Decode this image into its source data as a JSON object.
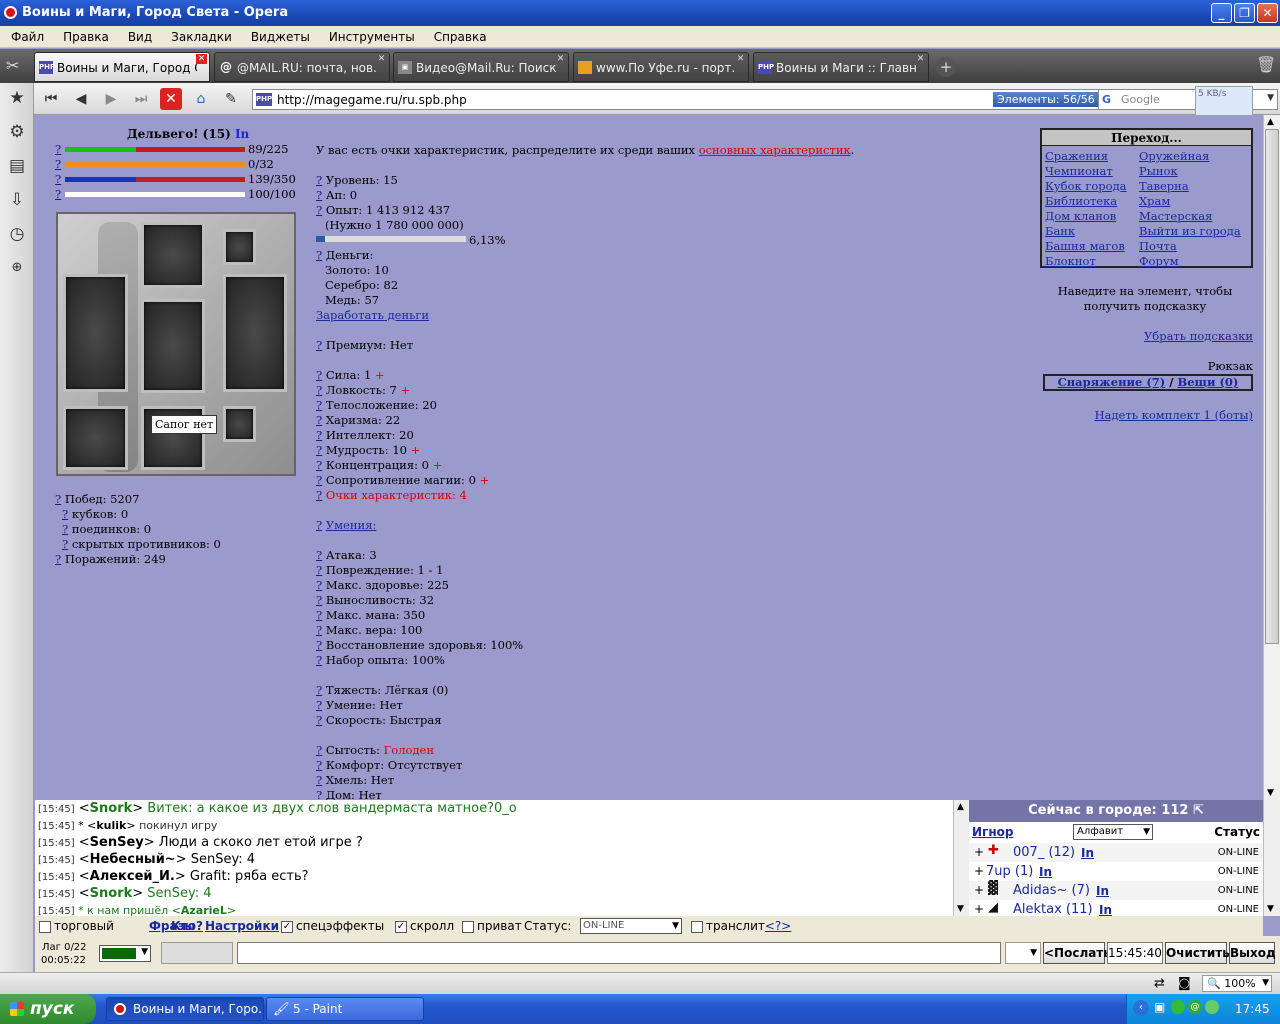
{
  "window": {
    "title": "Воины и Маги, Город Света - Opera"
  },
  "menu": [
    "Файл",
    "Правка",
    "Вид",
    "Закладки",
    "Виджеты",
    "Инструменты",
    "Справка"
  ],
  "tabs": [
    {
      "label": "Воины и Маги, Город С...",
      "active": true
    },
    {
      "label": "@MAIL.RU: почта, нов..."
    },
    {
      "label": "Видео@Mail.Ru: Поиск ..."
    },
    {
      "label": "www.По Уфе.ru - порт..."
    },
    {
      "label": "Воины и Маги :: Главная"
    }
  ],
  "nav": {
    "url": "http://magegame.ru/ru.spb.php",
    "elements": "Элементы:   56/56",
    "search_placeholder": "Google",
    "speed": "5 KB/s"
  },
  "char": {
    "name": "Дельвего! (15)",
    "in": "In",
    "hp": "89/225",
    "mana": "0/32",
    "faith": "139/350",
    "other": "100/100",
    "boots": "Сапог нет"
  },
  "wins": {
    "victories": "Побед: 5207",
    "cups": "кубков: 0",
    "duels": "поединков: 0",
    "hidden": "скрытых противников: 0",
    "defeats": "Поражений: 249"
  },
  "intro": {
    "text": "У вас есть очки характеристик, распределите их среди ваших ",
    "link": "основных характеристик",
    "end": "."
  },
  "stats": {
    "level": "Уровень: 15",
    "ap": "Ап: 0",
    "exp": "Опыт: 1 413 912 437",
    "need": "(Нужно 1 780 000 000)",
    "progress": "6,13%",
    "progress_fraction": 0.0613,
    "money": "Деньги:",
    "gold": "Золото: 10",
    "silver": "Серебро: 82",
    "copper": "Медь: 57",
    "earn": "Заработать деньги",
    "premium": "Премиум: Нет",
    "strength": "Сила: 1",
    "agility": "Ловкость: 7",
    "constitution": "Телосложение: 20",
    "charisma": "Харизма: 22",
    "intellect": "Интеллект: 20",
    "wisdom": "Мудрость: 10",
    "concentration": "Концентрация: 0",
    "magres": "Сопротивление магии: 0",
    "points": "Очки характеристик: 4",
    "skills": "Умения:",
    "attack": "Атака: 3",
    "damage": "Повреждение: 1 - 1",
    "maxhp": "Макс. здоровье: 225",
    "stamina": "Выносливость: 32",
    "maxmana": "Макс. мана: 350",
    "maxfaith": "Макс. вера: 100",
    "regen": "Восстановление здоровья: 100%",
    "expgain": "Набор опыта: 100%",
    "weight": "Тяжесть: Лёгкая (0)",
    "skill": "Умение: Нет",
    "speed": "Скорость: Быстрая",
    "satiety_label": "Сытость: ",
    "satiety": "Голоден",
    "comfort": "Комфорт: Отсутствует",
    "hops": "Хмель: Нет",
    "house": "Дом: Нет"
  },
  "navbox": {
    "title": "Переход...",
    "left": [
      "Сражения",
      "Чемпионат",
      "Кубок города",
      "Библиотека",
      "Дом кланов",
      "Банк",
      "Башня магов",
      "Блокнот"
    ],
    "right": [
      "Оружейная",
      "Рынок",
      "Таверна",
      "Храм",
      "Мастерская",
      "Выйти из города",
      "Почта",
      "Форум"
    ]
  },
  "right": {
    "hint": "Наведите на элемент, чтобы получить подсказку",
    "remove_hints": "Убрать подсказки",
    "backpack": "Рюкзак",
    "gear": "Снаряжение (7)",
    "sep": " / ",
    "things": "Вещи (0)",
    "set": "Надеть комплект 1 (боты)"
  },
  "chat": [
    {
      "t": "[15:45]",
      "pre": " <",
      "nick": "Snork",
      "post": "> ",
      "msg": "Витек: а какое из двух слов вандермаста матное?0_о",
      "green": true
    },
    {
      "t": "[15:45]",
      "pre": " * <",
      "nick": "kulik",
      "post": "> ",
      "msg": "покинул игру",
      "sys": true
    },
    {
      "t": "[15:45]",
      "pre": " <",
      "nick": "SenSey",
      "post": "> ",
      "msg": "Люди а скоко лет етой игре ?"
    },
    {
      "t": "[15:45]",
      "pre": " <",
      "nick": "Небесный~",
      "post": "> ",
      "msg": "SenSey: 4"
    },
    {
      "t": "[15:45]",
      "pre": " <",
      "nick": "Алексей_И.",
      "post": "> ",
      "msg": "Grafit: ряба есть?"
    },
    {
      "t": "[15:45]",
      "pre": " <",
      "nick": "Snork",
      "post": "> ",
      "msg": "SenSey: 4",
      "green": true
    },
    {
      "t": "[15:45]",
      "pre": " * к нам пришёл <",
      "nick": "AzarieL",
      "post": ">",
      "msg": "",
      "sys": true,
      "green": true
    }
  ],
  "online": {
    "title": "Сейчас в городе: 112",
    "ignore": "Игнор",
    "sort": "Алфавит",
    "status": "Статус",
    "users": [
      {
        "name": "007_ (12)",
        "in": "In",
        "st": "ON-LINE"
      },
      {
        "name": "7up (1)",
        "in": "In",
        "st": "ON-LINE"
      },
      {
        "name": "Adidas~ (7)",
        "in": "In",
        "st": "ON-LINE"
      },
      {
        "name": "Alektax (11)",
        "in": "In",
        "st": "ON-LINE"
      }
    ]
  },
  "controls": {
    "trade": "торговый",
    "phrases": "Фразы",
    "who": "Кто?",
    "settings": "Настройки",
    "effects": "спецэффекты",
    "scroll": "скролл",
    "private": "приват",
    "status_label": "Статус:",
    "status_val": "ON-LINE",
    "translit": "транслит",
    "translit_help": "<?>",
    "lag": "Лаг 0/22",
    "timer": "00:05:22",
    "send": "<Послать",
    "time": "15:45:40",
    "clear": "Очистить",
    "exit": "Выход"
  },
  "status": {
    "zoom": "100%"
  },
  "taskbar": {
    "start": "пуск",
    "tasks": [
      "Воины и Маги, Горо...",
      "5 - Paint"
    ],
    "lang": "RU",
    "clock": "17:45"
  }
}
